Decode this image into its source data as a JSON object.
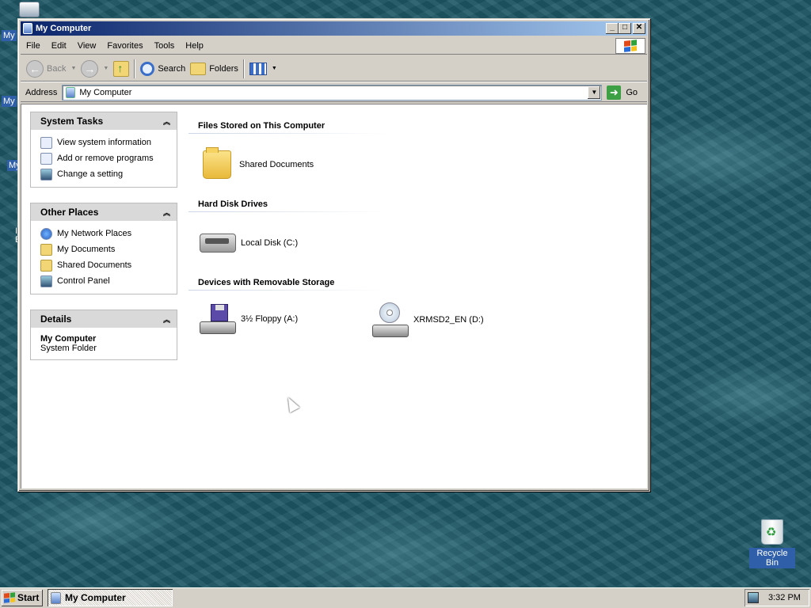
{
  "desktop": {
    "stubs": [
      "My",
      "My",
      "My",
      "I E"
    ],
    "recycle_bin": "Recycle Bin"
  },
  "window": {
    "title": "My Computer",
    "controls": {
      "minimize": "_",
      "maximize": "□",
      "close": "✕"
    },
    "menu": [
      "File",
      "Edit",
      "View",
      "Favorites",
      "Tools",
      "Help"
    ],
    "toolbar": {
      "back": "Back",
      "search": "Search",
      "folders": "Folders"
    },
    "address": {
      "label": "Address",
      "value": "My Computer",
      "go": "Go"
    }
  },
  "sidebar": {
    "system_tasks": {
      "title": "System Tasks",
      "items": [
        "View system information",
        "Add or remove programs",
        "Change a setting"
      ]
    },
    "other_places": {
      "title": "Other Places",
      "items": [
        "My Network Places",
        "My Documents",
        "Shared Documents",
        "Control Panel"
      ]
    },
    "details": {
      "title": "Details",
      "name": "My Computer",
      "type": "System Folder"
    }
  },
  "main": {
    "groups": [
      {
        "title": "Files Stored on This Computer",
        "items": [
          "Shared Documents"
        ]
      },
      {
        "title": "Hard Disk Drives",
        "items": [
          "Local Disk (C:)"
        ]
      },
      {
        "title": "Devices with Removable Storage",
        "items": [
          "3½ Floppy (A:)",
          "XRMSD2_EN (D:)"
        ]
      }
    ]
  },
  "taskbar": {
    "start": "Start",
    "window_button": "My Computer",
    "clock": "3:32 PM"
  }
}
